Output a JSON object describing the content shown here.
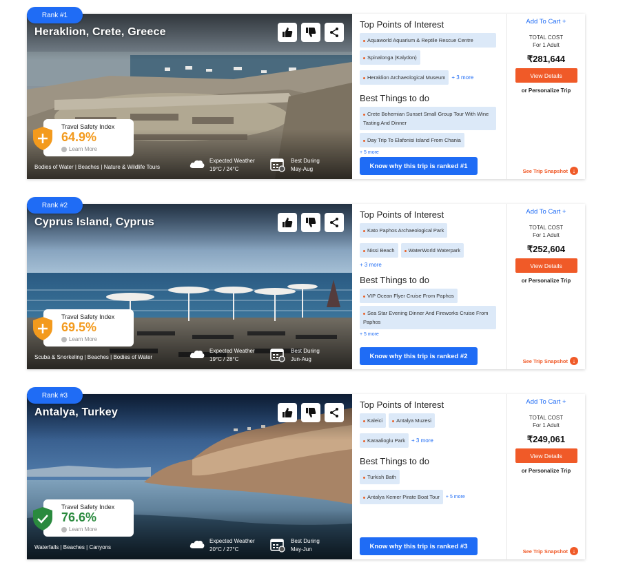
{
  "cards": [
    {
      "rank": "Rank #1",
      "title": "Heraklion, Crete, Greece",
      "safety_label": "Travel Safety Index",
      "safety_value": "64.9%",
      "safety_color": "#f39a1d",
      "learn_more": "Learn More",
      "tags": "Bodies of Water | Beaches | Nature & Wildlife Tours",
      "weather_label": "Expected Weather",
      "weather_value": "19°C / 24°C",
      "best_label": "Best During",
      "best_value": "May-Aug",
      "poi_title": "Top Points of Interest",
      "poi": [
        "Aquaworld Aquarium & Reptile Rescue Centre",
        "Spinalonga (Kalydon)",
        "Heraklion Archaeological Museum"
      ],
      "poi_more": "+ 3 more",
      "todo_title": "Best Things to do",
      "todo": [
        "Crete Bohemian Sunset Small Group Tour With Wine Tasting And Dinner",
        "Day Trip To Elafonisi Island From Chania"
      ],
      "todo_more": "+ 5 more",
      "rank_button": "Know why this trip is ranked #1",
      "cart": "Add To Cart +",
      "total_cost": "TOTAL COST",
      "for_adult": "For 1 Adult",
      "price": "₹281,644",
      "view_details": "View Details",
      "personalize": "or Personalize Trip",
      "snapshot": "See Trip Snapshot"
    },
    {
      "rank": "Rank #2",
      "title": "Cyprus Island, Cyprus",
      "safety_label": "Travel Safety Index",
      "safety_value": "69.5%",
      "safety_color": "#f39a1d",
      "learn_more": "Learn More",
      "tags": "Scuba & Snorkeling | Beaches | Bodies of Water",
      "weather_label": "Expected Weather",
      "weather_value": "19°C / 28°C",
      "best_label": "Best During",
      "best_value": "Jun-Aug",
      "poi_title": "Top Points of Interest",
      "poi": [
        "Kato Paphos Archaeological Park",
        "Nissi Beach",
        "WaterWorld Waterpark"
      ],
      "poi_more": "+ 3 more",
      "todo_title": "Best Things to do",
      "todo": [
        "VIP Ocean Flyer Cruise From Paphos",
        "Sea Star Evening Dinner And Fireworks Cruise From Paphos"
      ],
      "todo_more": "+ 5 more",
      "rank_button": "Know why this trip is ranked #2",
      "cart": "Add To Cart +",
      "total_cost": "TOTAL COST",
      "for_adult": "For 1 Adult",
      "price": "₹252,604",
      "view_details": "View Details",
      "personalize": "or Personalize Trip",
      "snapshot": "See Trip Snapshot"
    },
    {
      "rank": "Rank #3",
      "title": "Antalya, Turkey",
      "safety_label": "Travel Safety Index",
      "safety_value": "76.6%",
      "safety_color": "#2a8a3e",
      "learn_more": "Learn More",
      "tags": "Waterfalls | Beaches | Canyons",
      "weather_label": "Expected Weather",
      "weather_value": "20°C / 27°C",
      "best_label": "Best During",
      "best_value": "May-Jun",
      "poi_title": "Top Points of Interest",
      "poi": [
        "Kaleici",
        "Antalya Muzesi",
        "Karaalioglu Park"
      ],
      "poi_more": "+ 3 more",
      "todo_title": "Best Things to do",
      "todo": [
        "Turkish Bath",
        "Antalya Kemer Pirate Boat Tour"
      ],
      "todo_more": "+ 5 more",
      "rank_button": "Know why this trip is ranked #3",
      "cart": "Add To Cart +",
      "total_cost": "TOTAL COST",
      "for_adult": "For 1 Adult",
      "price": "₹249,061",
      "view_details": "View Details",
      "personalize": "or Personalize Trip",
      "snapshot": "See Trip Snapshot"
    }
  ],
  "icons": {
    "like": "thumbs-up-icon",
    "dislike": "thumbs-down-icon",
    "share": "share-icon",
    "weather": "cloud-icon",
    "calendar": "calendar-icon",
    "shield": "shield-icon",
    "snapshot": "arrow-down-circle-icon"
  }
}
